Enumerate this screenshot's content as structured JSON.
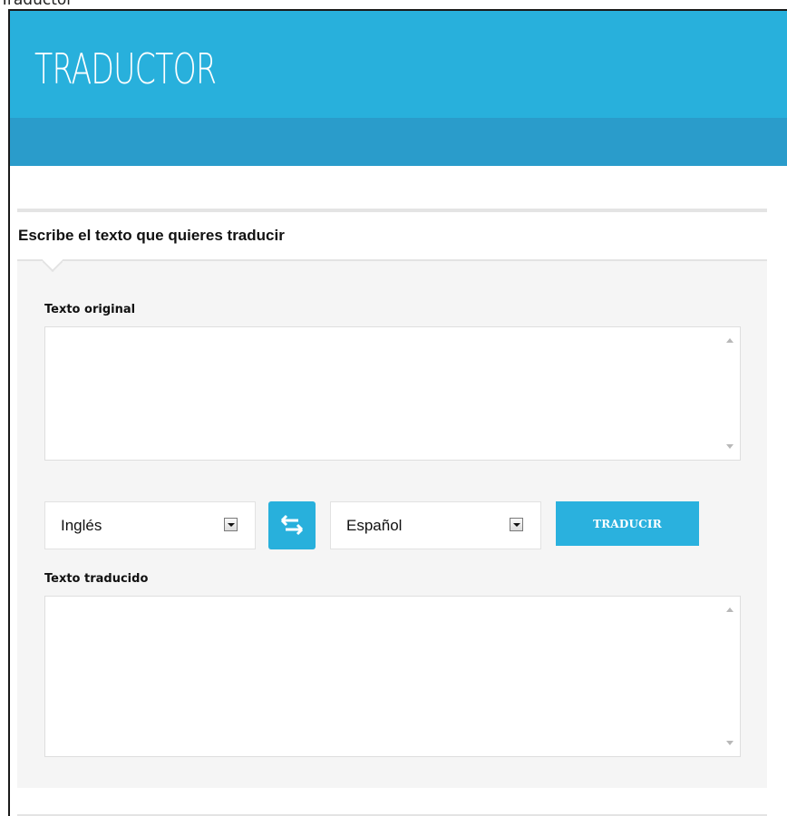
{
  "page": {
    "caption": "Traductor"
  },
  "header": {
    "title": "TRADUCTOR"
  },
  "section": {
    "title": "Escribe el texto que quieres traducir"
  },
  "original": {
    "label": "Texto original",
    "value": ""
  },
  "source_language": {
    "selected": "Inglés"
  },
  "swap": {
    "icon": "swap-arrows-icon"
  },
  "target_language": {
    "selected": "Español"
  },
  "translate_button": {
    "label": "TRADUCIR"
  },
  "translated": {
    "label": "Texto traducido",
    "value": ""
  },
  "colors": {
    "header": "#28b0dc",
    "header_bar": "#2a9ccb",
    "accent": "#2ab1de",
    "panel": "#f5f5f5"
  }
}
